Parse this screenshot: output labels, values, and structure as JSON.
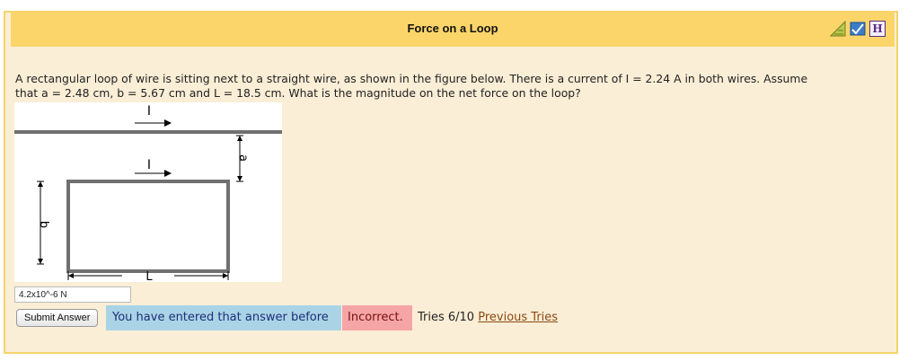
{
  "problem": {
    "title": "Force on a Loop",
    "question_line1": "A rectangular loop of wire is sitting next to a straight wire, as shown in the figure below. There is a current of I = 2.24 A in both wires. Assume",
    "question_line2": "that a = 2.48 cm, b = 5.67 cm and L = 18.5 cm. What is the magnitude on the net force on the loop?"
  },
  "figure": {
    "label_I_top": "I",
    "label_I_loop": "I",
    "label_a": "a",
    "label_b": "b",
    "label_L": "L"
  },
  "answer": {
    "value": "4.2x10^-6 N"
  },
  "actions": {
    "submit_label": "Submit Answer"
  },
  "feedback": {
    "info": "You have entered that answer before",
    "status": "Incorrect.",
    "tries": "Tries 6/10",
    "previous_tries_link": "Previous Tries"
  },
  "icons": [
    "discussion-icon",
    "feedback-icon",
    "help-icon"
  ],
  "colors": {
    "header": "#fcd56a",
    "panel": "#fbeed6",
    "info_bg": "#aad4e6",
    "incorrect_bg": "#f5a5a5"
  }
}
